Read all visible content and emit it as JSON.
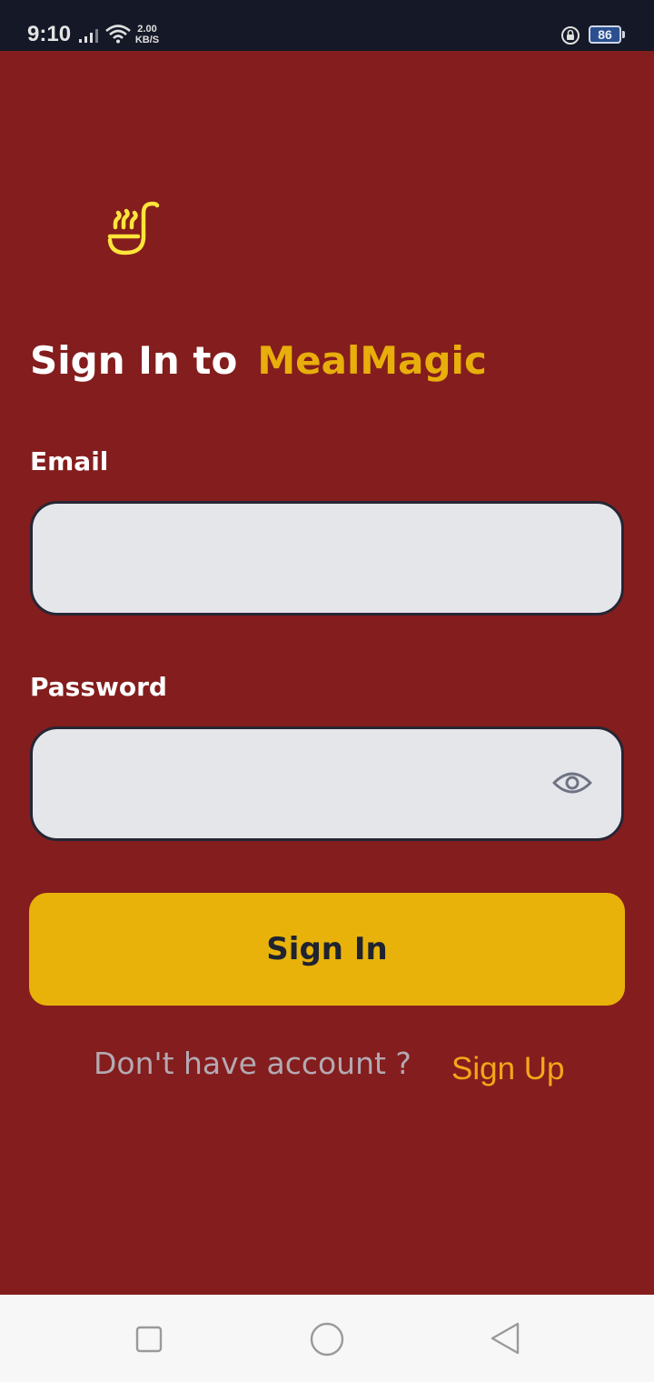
{
  "status_bar": {
    "time": "9:10",
    "net_speed_value": "2.00",
    "net_speed_unit": "KB/S",
    "battery_level": "86",
    "icons": [
      "signal-icon",
      "wifi-icon",
      "rotation-lock-icon",
      "battery-icon"
    ]
  },
  "logo": {
    "icon": "ladle-steam-icon",
    "color": "#ffe53b"
  },
  "heading": {
    "prefix": "Sign In to",
    "brand": "MealMagic"
  },
  "form": {
    "email_label": "Email",
    "email_value": "",
    "password_label": "Password",
    "password_value": "",
    "password_toggle_icon": "eye-icon",
    "submit_label": "Sign In"
  },
  "footer": {
    "prompt": "Don't have account ?",
    "link": "Sign Up"
  },
  "nav": {
    "icons": [
      "recents-square-icon",
      "home-circle-icon",
      "back-triangle-icon"
    ]
  },
  "colors": {
    "background": "#841d1d",
    "accent": "#e8b20a",
    "brand_text": "#e8ae0b",
    "link": "#f2a719",
    "input_fill": "#e5e6ea"
  }
}
